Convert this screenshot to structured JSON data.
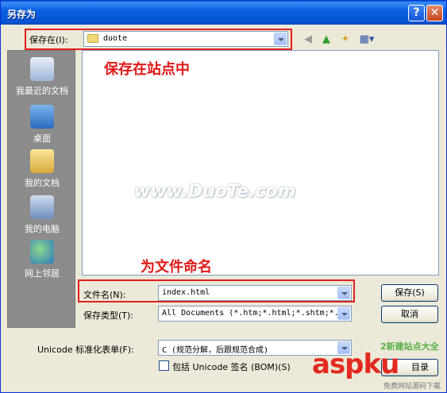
{
  "window": {
    "title": "另存为"
  },
  "titlebar": {
    "help_label": "?",
    "close_label": "✕"
  },
  "save_in": {
    "label": "保存在(I):",
    "value": "duote"
  },
  "places": [
    {
      "label": "我最近的文档",
      "icon": "recent-documents-icon"
    },
    {
      "label": "桌面",
      "icon": "desktop-icon"
    },
    {
      "label": "我的文档",
      "icon": "my-documents-icon"
    },
    {
      "label": "我的电脑",
      "icon": "my-computer-icon"
    },
    {
      "label": "网上邻居",
      "icon": "network-places-icon"
    }
  ],
  "annotations": {
    "save_in_site": "保存在站点中",
    "name_file": "为文件命名"
  },
  "watermark": "www.DuoTe.com",
  "filename": {
    "label": "文件名(N):",
    "value": "index.html"
  },
  "filetype": {
    "label": "保存类型(T):",
    "value": "All Documents (*.htm;*.html;*.shtm;*."
  },
  "encoding": {
    "label": "Unicode 标准化表单(F):",
    "value": "C (规范分解，后跟规范合成)"
  },
  "bom": {
    "label": "包括 Unicode 签名 (BOM)(S)"
  },
  "buttons": {
    "save": "保存(S)",
    "cancel": "取消",
    "site_dir": "目录"
  },
  "branding": {
    "main": "aspku",
    "sub": "2新建站点大全",
    "footer": "免费网站源码下载站!"
  },
  "colors": {
    "titlebar": "#0554d4",
    "annotation": "#e01818",
    "highlight_box": "#e02020",
    "places_bar": "#8c8c8c"
  }
}
